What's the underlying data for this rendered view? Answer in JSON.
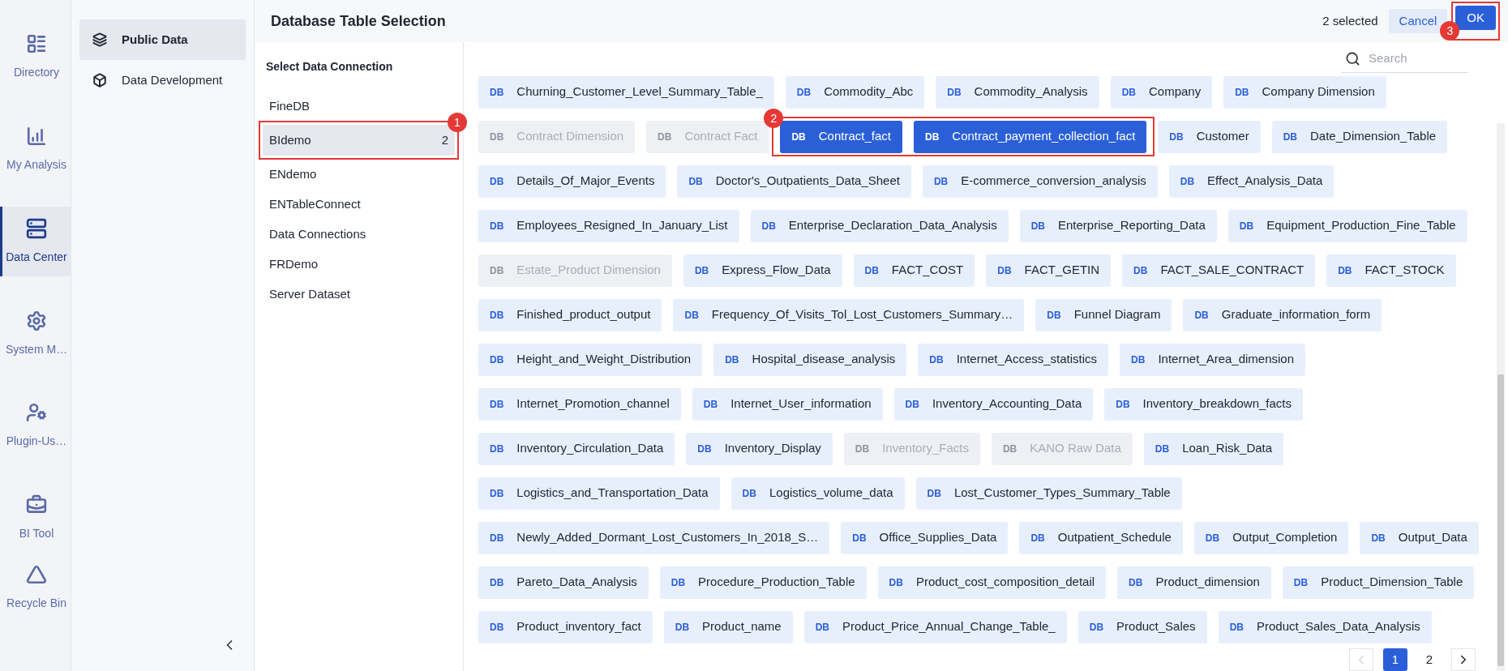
{
  "rail": [
    {
      "label": "Directory",
      "selected": false
    },
    {
      "label": "My Analysis",
      "selected": false
    },
    {
      "label": "Data Center",
      "selected": true
    },
    {
      "label": "System M…",
      "selected": false
    },
    {
      "label": "Plugin-Us…",
      "selected": false
    },
    {
      "label": "BI Tool",
      "selected": false
    },
    {
      "label": "Recycle Bin",
      "selected": false
    }
  ],
  "nav": [
    {
      "label": "Public Data",
      "selected": true
    },
    {
      "label": "Data Development",
      "selected": false
    }
  ],
  "dialog": {
    "title": "Database Table Selection",
    "selected_count": "2 selected",
    "cancel": "Cancel",
    "ok": "OK"
  },
  "connections_heading": "Select Data Connection",
  "connections": [
    {
      "name": "FineDB",
      "selected": false
    },
    {
      "name": "BIdemo",
      "count": "2",
      "selected": true
    },
    {
      "name": "ENdemo",
      "selected": false
    },
    {
      "name": "ENTableConnect",
      "selected": false
    },
    {
      "name": "Data Connections",
      "selected": false
    },
    {
      "name": "FRDemo",
      "selected": false
    },
    {
      "name": "Server Dataset",
      "selected": false
    }
  ],
  "search": {
    "placeholder": "Search"
  },
  "table_rows": [
    [
      {
        "name": "Churning_Customer_Level_Summary_Table_",
        "tag": "DB",
        "selected": false,
        "disabled": false
      },
      {
        "name": "Commodity_Abc",
        "tag": "DB",
        "selected": false,
        "disabled": false
      },
      {
        "name": "Commodity_Analysis",
        "tag": "DB",
        "selected": false,
        "disabled": false
      },
      {
        "name": "Company",
        "tag": "DB",
        "selected": false,
        "disabled": false
      },
      {
        "name": "Company Dimension",
        "tag": "DB",
        "selected": false,
        "disabled": false
      }
    ],
    [
      {
        "name": "Contract Dimension",
        "tag": "DB",
        "selected": false,
        "disabled": true
      },
      {
        "name": "Contract Fact",
        "tag": "DB",
        "selected": false,
        "disabled": true
      },
      {
        "name": "Contract_fact",
        "tag": "DB",
        "selected": true,
        "disabled": false
      },
      {
        "name": "Contract_payment_collection_fact",
        "tag": "DB",
        "selected": true,
        "disabled": false
      },
      {
        "name": "Customer",
        "tag": "DB",
        "selected": false,
        "disabled": false
      },
      {
        "name": "Date_Dimension_Table",
        "tag": "DB",
        "selected": false,
        "disabled": false
      }
    ],
    [
      {
        "name": "Details_Of_Major_Events",
        "tag": "DB",
        "selected": false,
        "disabled": false
      },
      {
        "name": "Doctor's_Outpatients_Data_Sheet",
        "tag": "DB",
        "selected": false,
        "disabled": false
      },
      {
        "name": "E-commerce_conversion_analysis",
        "tag": "DB",
        "selected": false,
        "disabled": false
      },
      {
        "name": "Effect_Analysis_Data",
        "tag": "DB",
        "selected": false,
        "disabled": false
      }
    ],
    [
      {
        "name": "Employees_Resigned_In_January_List",
        "tag": "DB",
        "selected": false,
        "disabled": false
      },
      {
        "name": "Enterprise_Declaration_Data_Analysis",
        "tag": "DB",
        "selected": false,
        "disabled": false
      },
      {
        "name": "Enterprise_Reporting_Data",
        "tag": "DB",
        "selected": false,
        "disabled": false
      },
      {
        "name": "Equipment_Production_Fine_Table",
        "tag": "DB",
        "selected": false,
        "disabled": false
      }
    ],
    [
      {
        "name": "Estate_Product Dimension",
        "tag": "DB",
        "selected": false,
        "disabled": true
      },
      {
        "name": "Express_Flow_Data",
        "tag": "DB",
        "selected": false,
        "disabled": false
      },
      {
        "name": "FACT_COST",
        "tag": "DB",
        "selected": false,
        "disabled": false
      },
      {
        "name": "FACT_GETIN",
        "tag": "DB",
        "selected": false,
        "disabled": false
      },
      {
        "name": "FACT_SALE_CONTRACT",
        "tag": "DB",
        "selected": false,
        "disabled": false
      },
      {
        "name": "FACT_STOCK",
        "tag": "DB",
        "selected": false,
        "disabled": false
      }
    ],
    [
      {
        "name": "Finished_product_output",
        "tag": "DB",
        "selected": false,
        "disabled": false
      },
      {
        "name": "Frequency_Of_Visits_Tol_Lost_Customers_Summary…",
        "tag": "DB",
        "selected": false,
        "disabled": false
      },
      {
        "name": "Funnel Diagram",
        "tag": "DB",
        "selected": false,
        "disabled": false
      },
      {
        "name": "Graduate_information_form",
        "tag": "DB",
        "selected": false,
        "disabled": false
      }
    ],
    [
      {
        "name": "Height_and_Weight_Distribution",
        "tag": "DB",
        "selected": false,
        "disabled": false
      },
      {
        "name": "Hospital_disease_analysis",
        "tag": "DB",
        "selected": false,
        "disabled": false
      },
      {
        "name": "Internet_Access_statistics",
        "tag": "DB",
        "selected": false,
        "disabled": false
      },
      {
        "name": "Internet_Area_dimension",
        "tag": "DB",
        "selected": false,
        "disabled": false
      }
    ],
    [
      {
        "name": "Internet_Promotion_channel",
        "tag": "DB",
        "selected": false,
        "disabled": false
      },
      {
        "name": "Internet_User_information",
        "tag": "DB",
        "selected": false,
        "disabled": false
      },
      {
        "name": "Inventory_Accounting_Data",
        "tag": "DB",
        "selected": false,
        "disabled": false
      },
      {
        "name": "Inventory_breakdown_facts",
        "tag": "DB",
        "selected": false,
        "disabled": false
      }
    ],
    [
      {
        "name": "Inventory_Circulation_Data",
        "tag": "DB",
        "selected": false,
        "disabled": false
      },
      {
        "name": "Inventory_Display",
        "tag": "DB",
        "selected": false,
        "disabled": false
      },
      {
        "name": "Inventory_Facts",
        "tag": "DB",
        "selected": false,
        "disabled": true
      },
      {
        "name": "KANO Raw Data",
        "tag": "DB",
        "selected": false,
        "disabled": true
      },
      {
        "name": "Loan_Risk_Data",
        "tag": "DB",
        "selected": false,
        "disabled": false
      }
    ],
    [
      {
        "name": "Logistics_and_Transportation_Data",
        "tag": "DB",
        "selected": false,
        "disabled": false
      },
      {
        "name": "Logistics_volume_data",
        "tag": "DB",
        "selected": false,
        "disabled": false
      },
      {
        "name": "Lost_Customer_Types_Summary_Table",
        "tag": "DB",
        "selected": false,
        "disabled": false
      }
    ],
    [
      {
        "name": "Newly_Added_Dormant_Lost_Customers_In_2018_S…",
        "tag": "DB",
        "selected": false,
        "disabled": false
      },
      {
        "name": "Office_Supplies_Data",
        "tag": "DB",
        "selected": false,
        "disabled": false
      },
      {
        "name": "Outpatient_Schedule",
        "tag": "DB",
        "selected": false,
        "disabled": false
      },
      {
        "name": "Output_Completion",
        "tag": "DB",
        "selected": false,
        "disabled": false
      },
      {
        "name": "Output_Data",
        "tag": "DB",
        "selected": false,
        "disabled": false
      }
    ],
    [
      {
        "name": "Pareto_Data_Analysis",
        "tag": "DB",
        "selected": false,
        "disabled": false
      },
      {
        "name": "Procedure_Production_Table",
        "tag": "DB",
        "selected": false,
        "disabled": false
      },
      {
        "name": "Product_cost_composition_detail",
        "tag": "DB",
        "selected": false,
        "disabled": false
      },
      {
        "name": "Product_dimension",
        "tag": "DB",
        "selected": false,
        "disabled": false
      },
      {
        "name": "Product_Dimension_Table",
        "tag": "DB",
        "selected": false,
        "disabled": false
      }
    ],
    [
      {
        "name": "Product_inventory_fact",
        "tag": "DB",
        "selected": false,
        "disabled": false
      },
      {
        "name": "Product_name",
        "tag": "DB",
        "selected": false,
        "disabled": false
      },
      {
        "name": "Product_Price_Annual_Change_Table_",
        "tag": "DB",
        "selected": false,
        "disabled": false
      },
      {
        "name": "Product_Sales",
        "tag": "DB",
        "selected": false,
        "disabled": false
      },
      {
        "name": "Product_Sales_Data_Analysis",
        "tag": "DB",
        "selected": false,
        "disabled": false
      }
    ]
  ],
  "pagination": {
    "prev_disabled": true,
    "pages": [
      {
        "label": "1",
        "selected": true
      },
      {
        "label": "2",
        "selected": false
      }
    ]
  },
  "annotations": [
    {
      "number": "1"
    },
    {
      "number": "2"
    },
    {
      "number": "3"
    }
  ]
}
